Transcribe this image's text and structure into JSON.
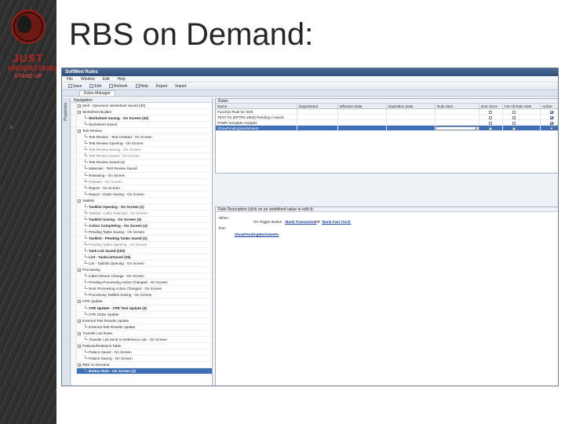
{
  "slide": {
    "title": "RBS on Demand:",
    "logo": {
      "line1": "JUST",
      "line2": "UNDERSTAND",
      "line3": "STAND UP"
    }
  },
  "app": {
    "window_title": "SoftMed Rules",
    "menu": [
      "File",
      "Window",
      "Edit",
      "Help"
    ],
    "toolbar": [
      "Save",
      "Edit",
      "Refresh",
      "Help",
      "Export",
      "Import"
    ],
    "tab": "Rules Manager",
    "side_dock_label": "Properties",
    "navigation": {
      "header": "Navigation",
      "items": [
        {
          "label": "Well - Specimen Worksheet Saved (30)",
          "kind": "group"
        },
        {
          "label": "Worksheet Builder",
          "kind": "group"
        },
        {
          "label": "Worksheet Saving - On Screen (34)",
          "kind": "child",
          "bold": true
        },
        {
          "label": "Worksheet Saved",
          "kind": "child"
        },
        {
          "label": "Test Review",
          "kind": "group"
        },
        {
          "label": "Test Review - Test Created - On Screen",
          "kind": "child"
        },
        {
          "label": "Test Review Opening - On Screen",
          "kind": "child"
        },
        {
          "label": "Test Review Saving - On Screen",
          "kind": "child",
          "faded": true
        },
        {
          "label": "Test Review Saved - On Screen",
          "kind": "child",
          "faded": true
        },
        {
          "label": "Test Review Saved (4)",
          "kind": "child"
        },
        {
          "label": "Materials - Test Review Saved",
          "kind": "child"
        },
        {
          "label": "Releasing - On Screen",
          "kind": "child"
        },
        {
          "label": "Release - On Screen",
          "kind": "child",
          "faded": true
        },
        {
          "label": "Report - On Screen",
          "kind": "child"
        },
        {
          "label": "Report - Order Saving - On Screen",
          "kind": "child"
        },
        {
          "label": "Tasklist",
          "kind": "group"
        },
        {
          "label": "Tasklist Opening - On Screen (1)",
          "kind": "child",
          "bold": true
        },
        {
          "label": "Tasklist - Links Selected - On Screen",
          "kind": "child",
          "faded": true
        },
        {
          "label": "Tasklist Saving - On Screen (3)",
          "kind": "child",
          "bold": true
        },
        {
          "label": "Action Completing - On Screen (4)",
          "kind": "child",
          "bold": true
        },
        {
          "label": "Pending Tasks Saving - On Screen",
          "kind": "child"
        },
        {
          "label": "Tasklist - Pending Tasks Saved (1)",
          "kind": "child",
          "bold": true
        },
        {
          "label": "Pending Tasks Opening - On Screen",
          "kind": "child",
          "faded": true
        },
        {
          "label": "Task List Saved (103)",
          "kind": "child",
          "bold": true
        },
        {
          "label": "List - TaskListSaved (35)",
          "kind": "child",
          "bold": true
        },
        {
          "label": "List - Tasklist Opening - On Screen",
          "kind": "child"
        },
        {
          "label": "Processing",
          "kind": "group"
        },
        {
          "label": "Initial Volume Change - On Screen",
          "kind": "child"
        },
        {
          "label": "Pending Processing Action Changed - On Screen",
          "kind": "child"
        },
        {
          "label": "Next Processing Action Changed - On Screen",
          "kind": "child"
        },
        {
          "label": "Processing Tasklist Saving - On Screen",
          "kind": "child"
        },
        {
          "label": "CPE Update",
          "kind": "group"
        },
        {
          "label": "CPE Update - CPE Test Update (4)",
          "kind": "child",
          "bold": true
        },
        {
          "label": "CPE Order Update",
          "kind": "child"
        },
        {
          "label": "External Test Results Update",
          "kind": "group"
        },
        {
          "label": "External Test Results Update",
          "kind": "child"
        },
        {
          "label": "Transfer List Rules",
          "kind": "group"
        },
        {
          "label": "Transfer List Send to Reference Lab - On Screen",
          "kind": "child"
        },
        {
          "label": "Patients/Relations Table",
          "kind": "group"
        },
        {
          "label": "Patient Saved - On Screen",
          "kind": "child"
        },
        {
          "label": "Patient Saving - On Screen",
          "kind": "child"
        },
        {
          "label": "RBS on Demand",
          "kind": "group"
        },
        {
          "label": "Button Rule - On Screen (1)",
          "kind": "child",
          "selected": true
        }
      ]
    },
    "rules": {
      "header": "Rules",
      "columns": [
        "Name",
        "Department",
        "Effective Date",
        "Expiration Date",
        "Rule Sets",
        "Dmr Once",
        "For All Rule Sets",
        "Active"
      ],
      "rows": [
        {
          "name": "Function Rule for SDK",
          "dmr": false,
          "all": false,
          "active": true
        },
        {
          "name": "TEST for (DPTRx 1500) Pending 2 saved",
          "dmr": false,
          "all": false,
          "active": true
        },
        {
          "name": "PostPI template Analysis",
          "dmr": false,
          "all": false,
          "active": true
        },
        {
          "name": "ShowPendingWorksheets",
          "dmr": false,
          "all": false,
          "active": true,
          "selected": true
        }
      ]
    },
    "rule_description": {
      "header": "Rule Description (click on an undefined value to edit it):",
      "when": "When",
      "trigger_text": "On Trigger Button",
      "trigger_link1": "'Bank Transaction'",
      "or": "OR",
      "trigger_link2": "'Bank Fast Track'",
      "then": "then",
      "action_link": "ShowPendingWorksheets"
    }
  }
}
